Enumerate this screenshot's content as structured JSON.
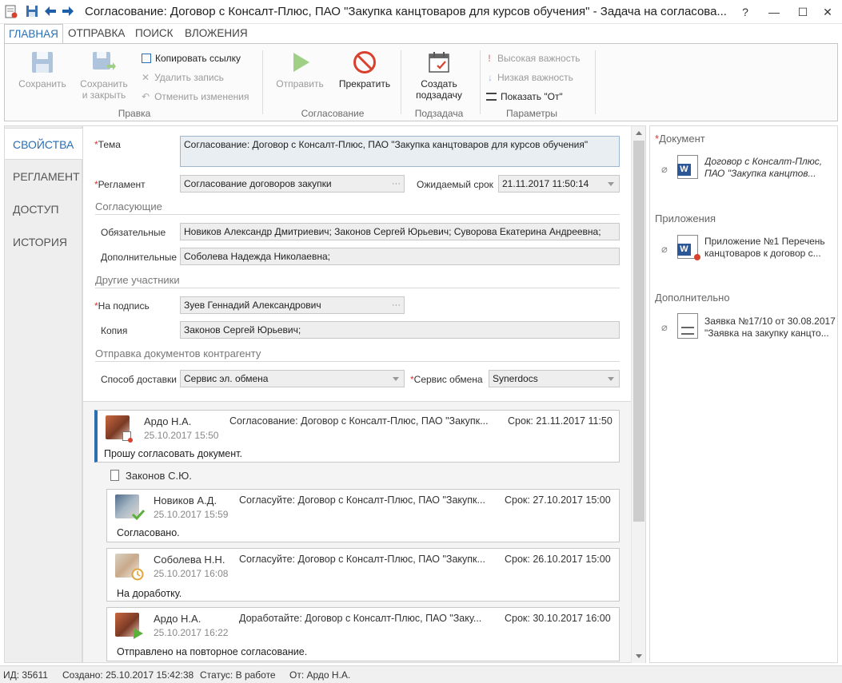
{
  "window": {
    "title": "Согласование: Договор с Консалт-Плюс, ПАО \"Закупка канцтоваров для курсов обучения\" - Задача на согласова...",
    "help_label": "?",
    "minimize_label": "—",
    "maximize_label": "☐",
    "close_label": "✕"
  },
  "tabs": [
    "ГЛАВНАЯ",
    "ОТПРАВКА",
    "ПОИСК",
    "ВЛОЖЕНИЯ"
  ],
  "ribbon": {
    "pravka": {
      "save": "Сохранить",
      "save_close_1": "Сохранить",
      "save_close_2": "и закрыть",
      "copy_link": "Копировать ссылку",
      "delete_record": "Удалить запись",
      "undo_changes": "Отменить изменения",
      "group": "Правка"
    },
    "soglasovanie": {
      "send": "Отправить",
      "stop": "Прекратить",
      "group": "Согласование"
    },
    "podzadacha": {
      "create_1": "Создать",
      "create_2": "подзадачу",
      "group": "Подзадача"
    },
    "parametry": {
      "high": "Высокая важность",
      "low": "Низкая важность",
      "show_from": "Показать \"От\"",
      "group": "Параметры"
    }
  },
  "nav": [
    "СВОЙСТВА",
    "РЕГЛАМЕНТ",
    "ДОСТУП",
    "ИСТОРИЯ"
  ],
  "form": {
    "required_mark": "*",
    "subject_label": "Тема",
    "subject_value": "Согласование: Договор с Консалт-Плюс, ПАО \"Закупка канцтоваров для курсов обучения\"",
    "reglament_label": "Регламент",
    "reglament_value": "Согласование договоров закупки",
    "due_label": "Ожидаемый срок",
    "due_value": "21.11.2017 11:50:14",
    "approvers_section": "Согласующие",
    "mandatory_label": "Обязательные",
    "mandatory_value": "Новиков Александр Дмитриевич; Законов Сергей Юрьевич; Суворова Екатерина Андреевна;",
    "additional_label": "Дополнительные",
    "additional_value": "Соболева Надежда Николаевна;",
    "other_section": "Другие участники",
    "sign_label": "На подпись",
    "sign_value": "Зуев Геннадий Александрович",
    "copy_label": "Копия",
    "copy_value": "Законов Сергей Юрьевич;",
    "counterparty_section": "Отправка документов контрагенту",
    "delivery_label": "Способ доставки",
    "delivery_value": "Сервис эл. обмена",
    "service_label": "Сервис обмена",
    "service_value": "Synerdocs",
    "ellipsis": "···"
  },
  "thread": {
    "main": {
      "author": "Ардо Н.А.",
      "date": "25.10.2017 15:50",
      "subject": "Согласование: Договор с Консалт-Плюс, ПАО \"Закупк...",
      "due": "Срок: 21.11.2017 11:50",
      "message": "Прошу согласовать документ."
    },
    "group_label": "Законов С.Ю.",
    "replies": [
      {
        "author": "Новиков А.Д.",
        "date": "25.10.2017 15:59",
        "subject": "Согласуйте: Договор с Консалт-Плюс, ПАО \"Закупк...",
        "due": "Срок: 27.10.2017 15:00",
        "message": "Согласовано."
      },
      {
        "author": "Соболева Н.Н.",
        "date": "25.10.2017 16:08",
        "subject": "Согласуйте: Договор с Консалт-Плюс, ПАО \"Закупк...",
        "due": "Срок: 26.10.2017 15:00",
        "message": "На доработку."
      },
      {
        "author": "Ардо Н.А.",
        "date": "25.10.2017 16:22",
        "subject": "Доработайте: Договор с Консалт-Плюс, ПАО \"Заку...",
        "due": "Срок: 30.10.2017 16:00",
        "message": "Отправлено на повторное согласование."
      }
    ]
  },
  "right": {
    "doc_section": "Документ",
    "doc_line1": "Договор с Консалт-Плюс,",
    "doc_line2": "ПАО \"Закупка канцтов...",
    "app_section": "Приложения",
    "app_line1": "Приложение №1 Перечень",
    "app_line2": "канцтоваров к договор с...",
    "extra_section": "Дополнительно",
    "extra_line1": "Заявка №17/10 от 30.08.2017",
    "extra_line2": "\"Заявка на закупку канцто..."
  },
  "statusbar": {
    "id": "ИД: 35611",
    "created": "Создано: 25.10.2017 15:42:38",
    "status": "Статус: В работе",
    "from": "От: Ардо Н.А."
  },
  "colors": {
    "accent": "#2a6fb4",
    "required": "#d33333",
    "send_green": "#8ccf6a",
    "stop_red": "#d9412f",
    "approved_green": "#5bb03b"
  }
}
